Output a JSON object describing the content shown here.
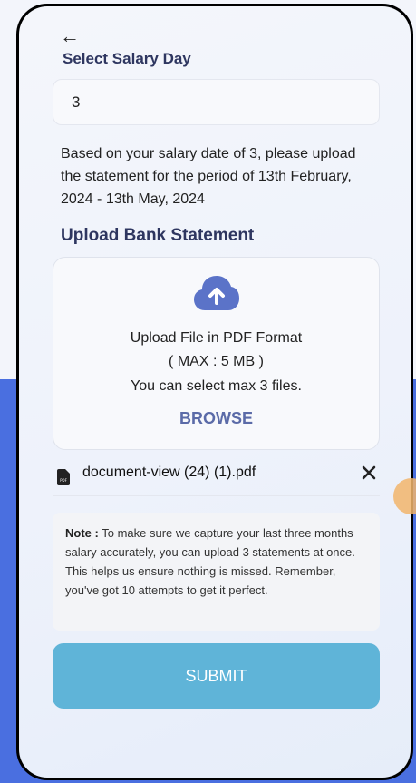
{
  "header": {
    "back_icon": "arrow-left-icon",
    "select_salary_day_label": "Select Salary Day"
  },
  "salary_day": {
    "value": "3"
  },
  "info": {
    "text": "Based on your salary date of 3, please upload the statement for the period of 13th February, 2024 - 13th May, 2024"
  },
  "upload": {
    "title": "Upload Bank Statement",
    "icon": "cloud-upload-icon",
    "line1": "Upload File in PDF Format",
    "line2": "( MAX : 5 MB )",
    "line3": "You can select max 3 files.",
    "browse_label": "BROWSE"
  },
  "files": [
    {
      "icon": "pdf-file-icon",
      "name": "document-view (24) (1).pdf"
    }
  ],
  "note": {
    "prefix": "Note :",
    "text": " To make sure we capture your last three months salary accurately, you can upload 3 statements at once. This helps us ensure nothing is missed. Remember, you've got 10 attempts to get it perfect."
  },
  "submit_label": "SUBMIT",
  "colors": {
    "accent": "#5fb4d8",
    "heading": "#2e3660",
    "browse": "#5b6ba8",
    "cloud": "#5b73c8",
    "background_blue": "#4a6fe0"
  }
}
